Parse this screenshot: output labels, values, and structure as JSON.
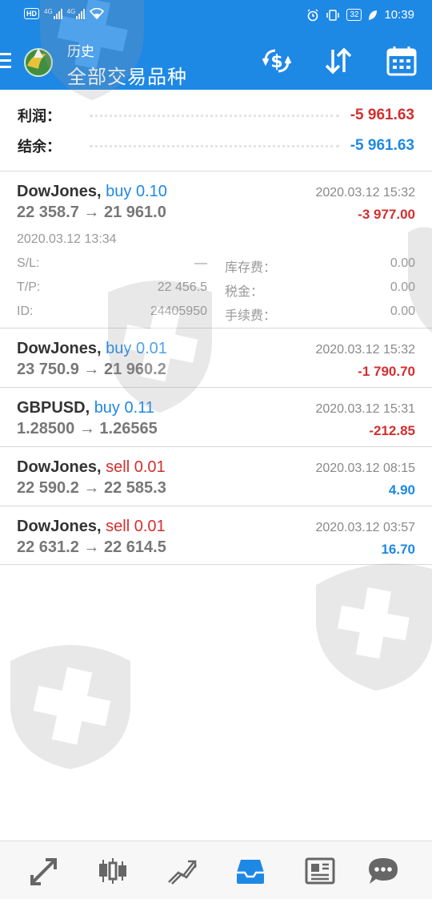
{
  "status_bar": {
    "hd": "HD",
    "net1": "4G",
    "net2": "4G",
    "battery": "32",
    "time": "10:39"
  },
  "header": {
    "subtitle": "历史",
    "title": "全部交易品种"
  },
  "summary": {
    "profit_label": "利润：",
    "profit_value": "-5 961.63",
    "balance_label": "结余：",
    "balance_value": "-5 961.63"
  },
  "trades": [
    {
      "symbol": "DowJones,",
      "direction": "buy 0.10",
      "prices": "22 358.7 → 21 961.0",
      "close_time": "2020.03.12 15:32",
      "profit": "-3 977.00",
      "open_time": "2020.03.12 13:34",
      "details": {
        "sl_label": "S/L:",
        "sl_value": "—",
        "tp_label": "T/P:",
        "tp_value": "22 456.5",
        "id_label": "ID:",
        "id_value": "24405950",
        "swap_label": "库存费：",
        "swap_value": "0.00",
        "tax_label": "税金：",
        "tax_value": "0.00",
        "commission_label": "手续费：",
        "commission_value": "0.00"
      }
    },
    {
      "symbol": "DowJones,",
      "direction": "buy 0.01",
      "prices": "23 750.9 → 21 960.2",
      "close_time": "2020.03.12 15:32",
      "profit": "-1 790.70"
    },
    {
      "symbol": "GBPUSD,",
      "direction": "buy 0.11",
      "prices": "1.28500 → 1.26565",
      "close_time": "2020.03.12 15:31",
      "profit": "-212.85"
    },
    {
      "symbol": "DowJones,",
      "direction": "sell 0.01",
      "prices": "22 590.2 → 22 585.3",
      "close_time": "2020.03.12 08:15",
      "profit": "4.90"
    },
    {
      "symbol": "DowJones,",
      "direction": "sell 0.01",
      "prices": "22 631.2 → 22 614.5",
      "close_time": "2020.03.12 03:57",
      "profit": "16.70"
    }
  ],
  "colors": {
    "accent": "#1e88e5",
    "loss": "#d32f2f",
    "gain": "#1e88e5",
    "sell": "#d32f2f"
  },
  "bottom_nav": [
    "quotes-icon",
    "chart-icon",
    "trade-icon",
    "history-icon",
    "news-icon",
    "chat-icon"
  ]
}
